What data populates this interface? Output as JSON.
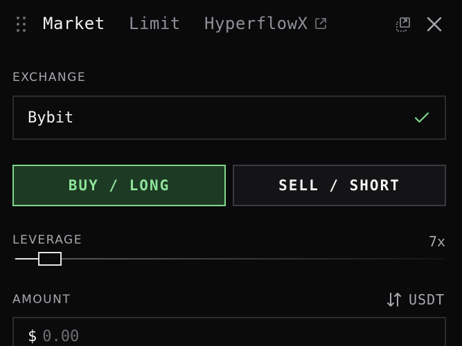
{
  "header": {
    "tabs": [
      {
        "label": "Market",
        "active": true
      },
      {
        "label": "Limit",
        "active": false
      },
      {
        "label": "HyperflowX",
        "active": false
      }
    ]
  },
  "exchange": {
    "label": "EXCHANGE",
    "value": "Bybit"
  },
  "side": {
    "buy_label": "BUY / LONG",
    "sell_label": "SELL / SHORT",
    "selected": "buy"
  },
  "leverage": {
    "label": "LEVERAGE",
    "value": "7x"
  },
  "amount": {
    "label": "AMOUNT",
    "currency_symbol": "$",
    "unit": "USDT",
    "placeholder": "0.00"
  },
  "colors": {
    "background": "#0a0a0b",
    "buy_accent": "#7fd78a",
    "buy_bg": "#1d3a24",
    "check": "#7fd78a"
  },
  "icons": [
    "drag-handle-icon",
    "external-link-icon",
    "popout-icon",
    "close-icon",
    "check-icon",
    "swap-icon"
  ]
}
